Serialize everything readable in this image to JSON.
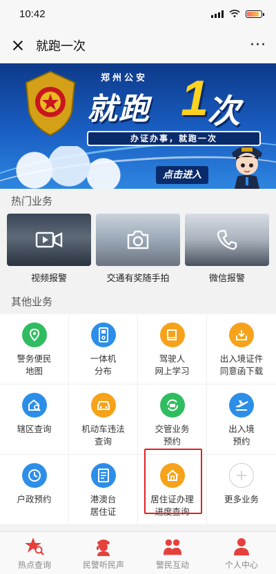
{
  "status_bar": {
    "time": "10:42"
  },
  "nav": {
    "title": "就跑一次",
    "more": "···"
  },
  "banner": {
    "top_text": "郑州公安",
    "main_text": "就跑",
    "numeral": "1",
    "main_text_end": "次",
    "ribbon": "办证办事，就跑一次",
    "cta": "点击进入"
  },
  "hot": {
    "title": "热门业务",
    "items": [
      {
        "label": "视频报警",
        "icon": "video-camera-icon"
      },
      {
        "label": "交通有奖随手拍",
        "icon": "camera-icon"
      },
      {
        "label": "微信报警",
        "icon": "phone-icon"
      }
    ]
  },
  "other": {
    "title": "其他业务",
    "items": [
      {
        "line1": "警务便民",
        "line2": "地图",
        "icon": "map-pin-icon",
        "color": "#2fbd5f"
      },
      {
        "line1": "一体机",
        "line2": "分布",
        "icon": "kiosk-icon",
        "color": "#2c8ee8"
      },
      {
        "line1": "驾驶人",
        "line2": "网上学习",
        "icon": "book-icon",
        "color": "#f7a21b"
      },
      {
        "line1": "出入境证件",
        "line2": "同意函下载",
        "icon": "download-tray-icon",
        "color": "#f7a21b"
      },
      {
        "line1": "辖区查询",
        "line2": "",
        "icon": "house-search-icon",
        "color": "#2c8ee8"
      },
      {
        "line1": "机动车违法",
        "line2": "查询",
        "icon": "car-icon",
        "color": "#f7a21b"
      },
      {
        "line1": "交管业务",
        "line2": "预约",
        "icon": "car-refresh-icon",
        "color": "#2fbd5f"
      },
      {
        "line1": "出入境",
        "line2": "预约",
        "icon": "airplane-icon",
        "color": "#2c8ee8"
      },
      {
        "line1": "户政预约",
        "line2": "",
        "icon": "clock-icon",
        "color": "#2c8ee8"
      },
      {
        "line1": "港澳台",
        "line2": "居住证",
        "icon": "document-icon",
        "color": "#2c8ee8"
      },
      {
        "line1": "居住证办理",
        "line2": "进度查询",
        "icon": "home-icon",
        "color": "#f7a21b"
      },
      {
        "line1": "更多业务",
        "line2": "",
        "icon": "plus-icon",
        "color": "#cccccc"
      }
    ]
  },
  "tabs": [
    {
      "label": "热点查询",
      "icon": "star-search-icon"
    },
    {
      "label": "民警听民声",
      "icon": "police-headset-icon"
    },
    {
      "label": "警民互动",
      "icon": "people-icon"
    },
    {
      "label": "个人中心",
      "icon": "person-icon"
    }
  ],
  "colors": {
    "accent_red": "#e5403c",
    "highlight_border": "#e02020",
    "banner_blue": "#1a5fc4"
  }
}
